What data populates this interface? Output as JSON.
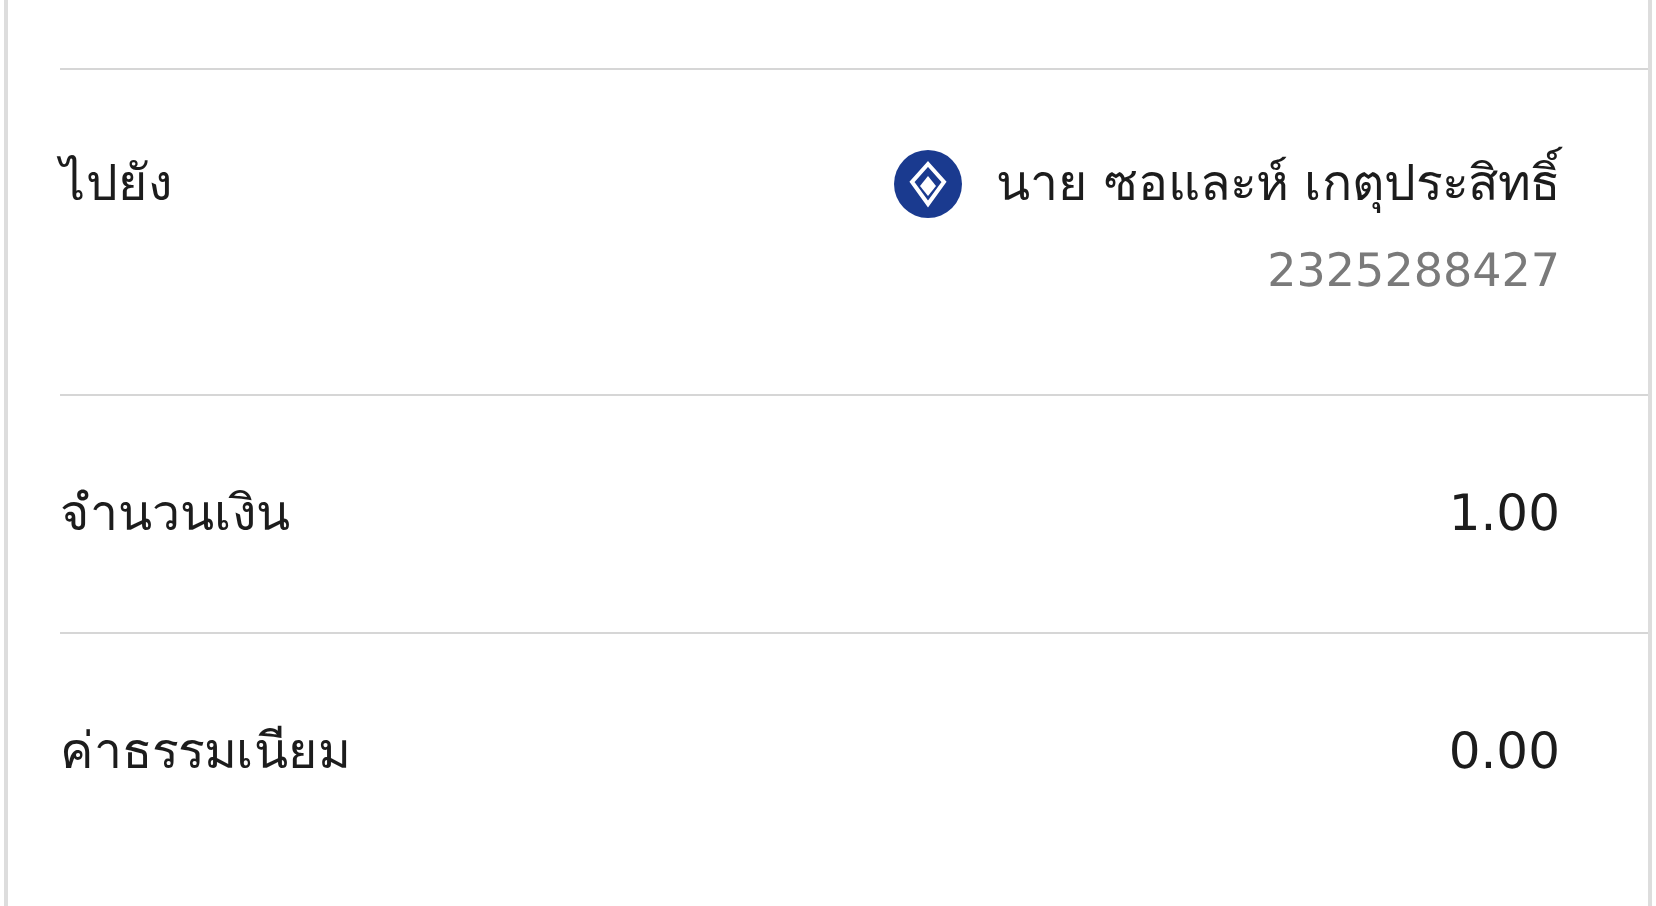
{
  "rows": [
    {
      "kind": "recipient",
      "label": "ไปยัง",
      "name": "นาย ซอและห์ เกตุประสิทธิ์",
      "account": "2325288427"
    },
    {
      "kind": "amount",
      "label": "จำนวนเงิน",
      "value": "1.00"
    },
    {
      "kind": "amount",
      "label": "ค่าธรรมเนียม",
      "value": "0.00"
    }
  ]
}
